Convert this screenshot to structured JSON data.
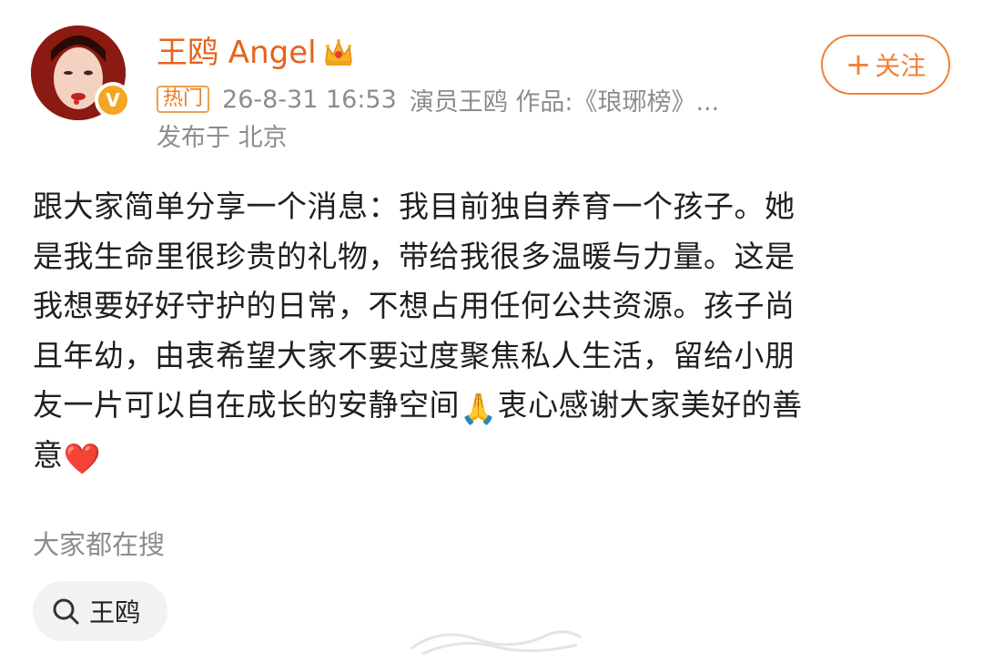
{
  "author": {
    "name": "王鸥 Angel",
    "avatar_icon": "avatar-portrait",
    "verified_icon": "verified-v-icon",
    "verified_mark": "V",
    "crown_icon": "crown-icon"
  },
  "follow": {
    "plus": "+",
    "label": "关注"
  },
  "meta": {
    "hot_badge": "热门",
    "timestamp": "26-8-31 16:53",
    "source": "演员王鸥 作品:《琅琊榜》...",
    "location": "发布于 北京"
  },
  "post": {
    "lines": [
      "跟大家简单分享一个消息：我目前独自养育一个孩子。她",
      "是我生命里很珍贵的礼物，带给我很多温暖与力量。这是",
      "我想要好好守护的日常，不想占用任何公共资源。孩子尚",
      "且年幼，由衷希望大家不要过度聚焦私人生活，留给小朋",
      "友一片可以自在成长的安静空间",
      "意"
    ],
    "line5_emoji": "🙏",
    "line5_tail": "衷心感谢大家美好的善",
    "line6_emoji": "❤️"
  },
  "search": {
    "heading": "大家都在搜",
    "chip_label": "王鸥"
  },
  "colors": {
    "accent": "#e6631a",
    "follow": "#f0813a",
    "meta_gray": "#8c8c8c",
    "chip_bg": "#f2f2f2"
  }
}
